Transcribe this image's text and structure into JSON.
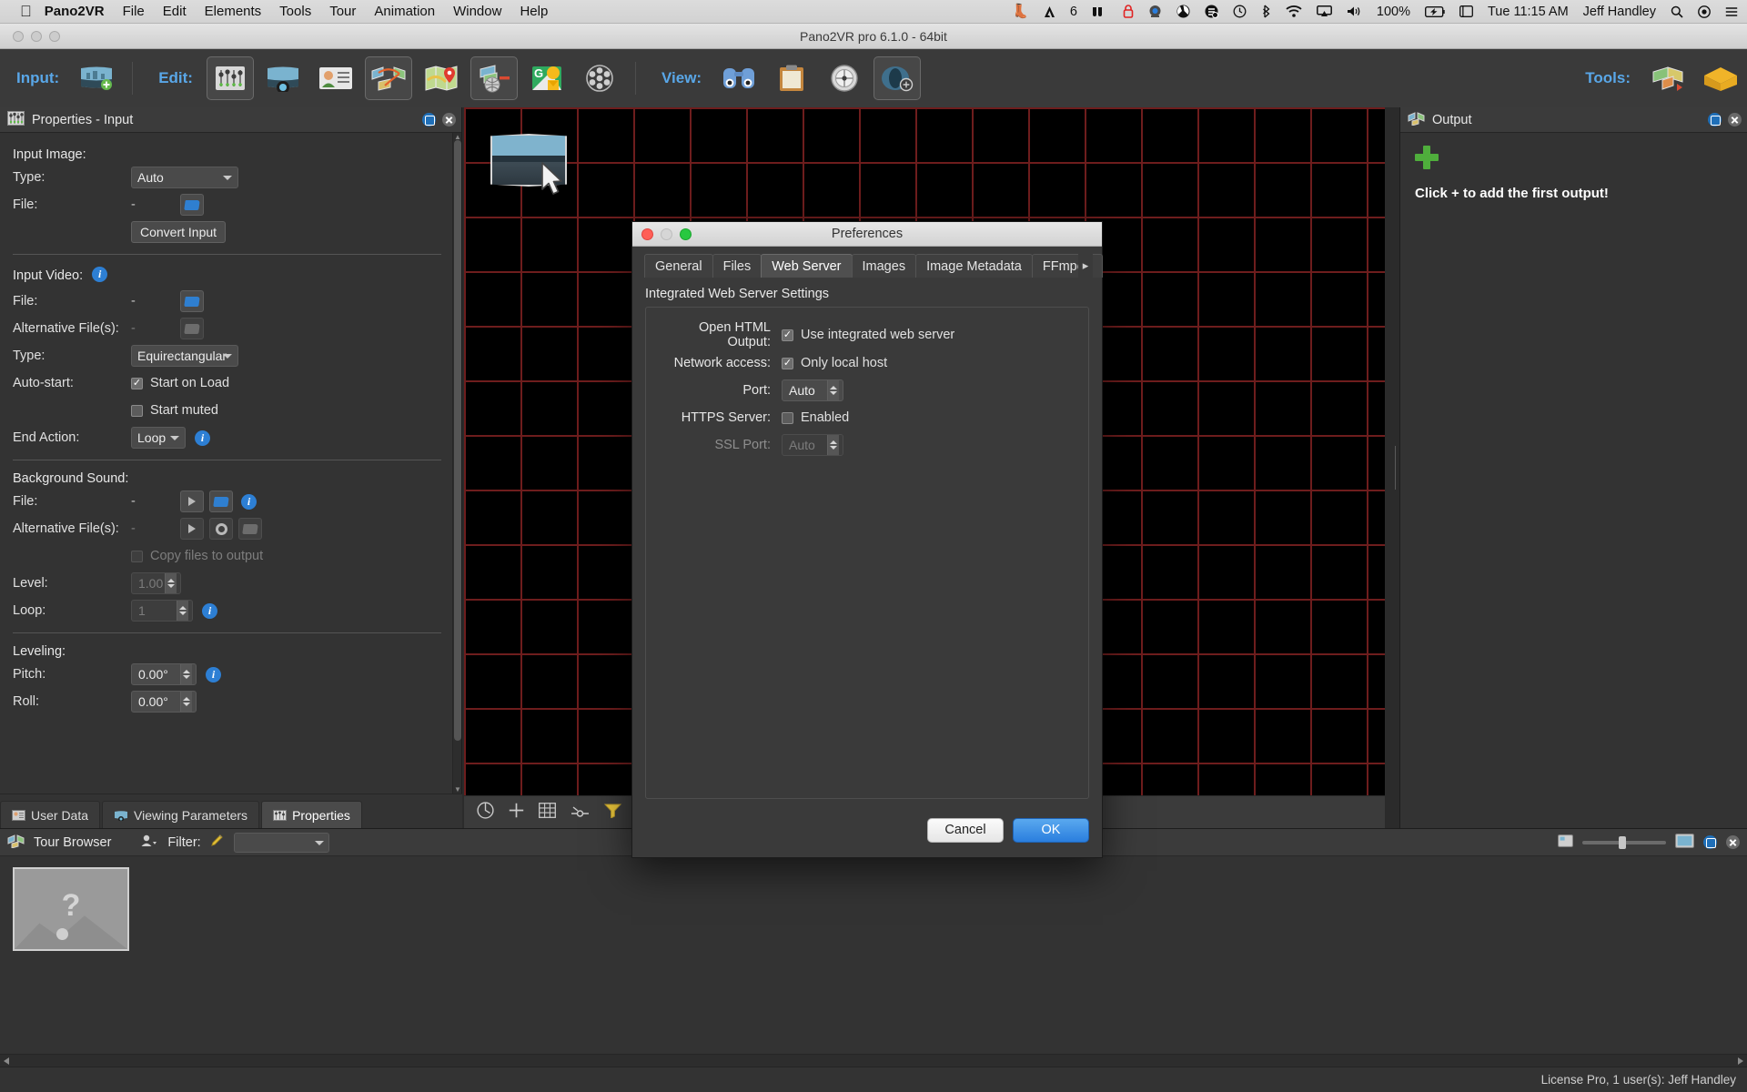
{
  "menubar": {
    "apple": "",
    "app_name": "Pano2VR",
    "items": [
      "File",
      "Edit",
      "Elements",
      "Tools",
      "Tour",
      "Animation",
      "Window",
      "Help"
    ],
    "status_icons": [
      "evernote-icon",
      "adobe-icon",
      "wacom-icon",
      "lock-icon",
      "camera-icon",
      "dropbox-icon",
      "sync-icon",
      "timemachine-icon",
      "bluetooth-icon",
      "wifi-icon",
      "airplay-icon",
      "volume-icon"
    ],
    "adobe_count": "6",
    "battery_percent": "100%",
    "battery_icon": "battery-charging-icon",
    "datetime": "Tue 11:15 AM",
    "user": "Jeff Handley",
    "search_icon": "search-icon",
    "siri_icon": "siri-icon",
    "notifications_icon": "notification-center-icon"
  },
  "window": {
    "title": "Pano2VR pro 6.1.0 - 64bit"
  },
  "toolbar": {
    "input_label": "Input:",
    "edit_label": "Edit:",
    "view_label": "View:",
    "tools_label": "Tools:",
    "buttons": [
      {
        "name": "open-input-image",
        "icon": "panorama-add-icon"
      },
      {
        "name": "properties",
        "icon": "sliders-icon",
        "selected": true
      },
      {
        "name": "viewing-parameters",
        "icon": "panorama-view-icon"
      },
      {
        "name": "user-data",
        "icon": "user-card-icon"
      },
      {
        "name": "tour-editor",
        "icon": "tour-nodes-icon",
        "selected": true
      },
      {
        "name": "map-editor",
        "icon": "map-pin-icon"
      },
      {
        "name": "skin-editor",
        "icon": "skin-editor-icon",
        "selected": true
      },
      {
        "name": "google-street-view",
        "icon": "google-streetview-icon"
      },
      {
        "name": "animation-editor",
        "icon": "film-reel-icon"
      },
      {
        "name": "preview",
        "icon": "binoculars-icon"
      },
      {
        "name": "clipboard-output",
        "icon": "clipboard-icon"
      },
      {
        "name": "viewer-settings",
        "icon": "compass-icon"
      },
      {
        "name": "mask-view",
        "icon": "mask-icon",
        "selected": true
      },
      {
        "name": "patch-tool",
        "icon": "patch-tool-icon"
      },
      {
        "name": "package-tool",
        "icon": "package-icon"
      }
    ]
  },
  "properties_panel": {
    "title": "Properties - Input",
    "icon": "sliders-icon",
    "float_button": "float-panel-button",
    "close_button": "close-panel-button",
    "sections": {
      "input_image": {
        "heading": "Input Image:",
        "type_label": "Type:",
        "type_value": "Auto",
        "file_label": "File:",
        "file_value": "-",
        "browse_icon": "folder-open-icon",
        "convert_button": "Convert Input"
      },
      "input_video": {
        "heading": "Input Video:",
        "info_icon": "info-icon",
        "file_label": "File:",
        "file_value": "-",
        "alt_label": "Alternative File(s):",
        "alt_value": "-",
        "type_label": "Type:",
        "type_value": "Equirectangular",
        "autostart_label": "Auto-start:",
        "start_on_load": "Start on Load",
        "start_on_load_checked": true,
        "start_muted": "Start muted",
        "start_muted_checked": false,
        "end_action_label": "End Action:",
        "end_action_value": "Loop"
      },
      "background_sound": {
        "heading": "Background Sound:",
        "file_label": "File:",
        "file_value": "-",
        "alt_label": "Alternative File(s):",
        "alt_value": "-",
        "copy_files_label": "Copy files to output",
        "copy_files_checked": false,
        "level_label": "Level:",
        "level_value": "1.00",
        "loop_label": "Loop:",
        "loop_value": "1",
        "play_icon": "play-icon",
        "gear_icon": "gear-icon",
        "folder_icon": "folder-open-icon"
      },
      "leveling": {
        "heading": "Leveling:",
        "pitch_label": "Pitch:",
        "pitch_value": "0.00°",
        "roll_label": "Roll:",
        "roll_value": "0.00°"
      }
    },
    "tabs": [
      {
        "label": "User Data",
        "icon": "user-data-icon",
        "active": false
      },
      {
        "label": "Viewing Parameters",
        "icon": "viewing-params-icon",
        "active": false
      },
      {
        "label": "Properties",
        "icon": "properties-icon",
        "active": true
      }
    ]
  },
  "canvas": {
    "tools": [
      "pitch-roll-icon",
      "crosshair-icon",
      "grid-icon",
      "level-icon",
      "filter-icon",
      "shape-icon"
    ],
    "thumbnail": "panorama-thumbnail",
    "cursor": "arrow-cursor"
  },
  "output_panel": {
    "title": "Output",
    "icon": "output-icon",
    "add_icon": "plus-icon",
    "empty_message": "Click + to add the first output!",
    "float_button": "float-panel-button",
    "close_button": "close-panel-button"
  },
  "tour_browser": {
    "title": "Tour Browser",
    "icon": "tour-browser-icon",
    "user_icon": "user-filter-icon",
    "filter_label": "Filter:",
    "filter_icon": "pencil-icon",
    "filter_value": "",
    "thumb_small_icon": "small-thumbnails-icon",
    "thumb_large_icon": "large-thumbnails-icon",
    "float_button": "float-panel-button",
    "close_button": "close-panel-button",
    "node_label": "?"
  },
  "statusbar": {
    "license": "License Pro, 1 user(s): Jeff Handley"
  },
  "preferences_dialog": {
    "title": "Preferences",
    "tabs": [
      {
        "label": "General",
        "active": false
      },
      {
        "label": "Files",
        "active": false
      },
      {
        "label": "Web Server",
        "active": true
      },
      {
        "label": "Images",
        "active": false
      },
      {
        "label": "Image Metadata",
        "active": false
      },
      {
        "label": "FFmpeg",
        "active": false
      }
    ],
    "tabs_next_icon": "chevron-right-icon",
    "section_title": "Integrated Web Server Settings",
    "fields": [
      {
        "label": "Open HTML Output:",
        "control": "checkbox",
        "checkbox_label": "Use integrated web server",
        "checked": true,
        "disabled": false
      },
      {
        "label": "Network access:",
        "control": "checkbox",
        "checkbox_label": "Only local host",
        "checked": true,
        "disabled": false
      },
      {
        "label": "Port:",
        "control": "spinner",
        "value": "Auto",
        "disabled": false
      },
      {
        "label": "HTTPS Server:",
        "control": "checkbox",
        "checkbox_label": "Enabled",
        "checked": false,
        "disabled": false
      },
      {
        "label": "SSL Port:",
        "control": "spinner",
        "value": "Auto",
        "disabled": true
      }
    ],
    "cancel_label": "Cancel",
    "ok_label": "OK"
  },
  "colors": {
    "accent_blue": "#59a7e8",
    "grid_red": "#6e1d1d",
    "panel_bg": "#333333",
    "toolbar_bg": "#3a3a3a",
    "ok_button": "#2a7ede",
    "plus_green": "#4fae3c"
  }
}
